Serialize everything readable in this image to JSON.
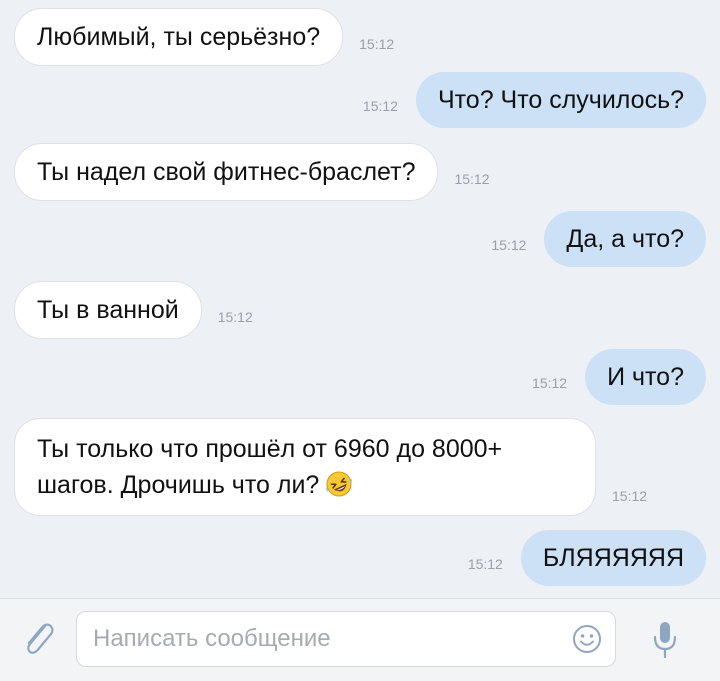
{
  "messages": [
    {
      "direction": "in",
      "text": "Любимый, ты серьёзно?",
      "time": "15:12"
    },
    {
      "direction": "out",
      "text": "Что? Что случилось?",
      "time": "15:12"
    },
    {
      "direction": "in",
      "text": "Ты надел свой фитнес-браслет?",
      "time": "15:12"
    },
    {
      "direction": "out",
      "text": "Да, а что?",
      "time": "15:12"
    },
    {
      "direction": "in",
      "text": "Ты в ванной",
      "time": "15:12"
    },
    {
      "direction": "out",
      "text": "И что?",
      "time": "15:12"
    },
    {
      "direction": "in",
      "text": "Ты только что прошёл от 6960 до 8000+ шагов. Дрочишь что ли?",
      "emoji": "rolling-on-the-floor-laughing-emoji",
      "time": "15:12"
    },
    {
      "direction": "out",
      "text": "БЛЯЯЯЯЯЯ",
      "time": "15:12"
    }
  ],
  "composer": {
    "placeholder": "Написать сообщение",
    "icons": [
      "paperclip-icon",
      "smile-icon",
      "microphone-icon"
    ]
  },
  "colors": {
    "background": "#edf0f5",
    "incoming_bubble": "#ffffff",
    "outgoing_bubble": "#cce0f6",
    "icon": "#8fa6c1"
  }
}
